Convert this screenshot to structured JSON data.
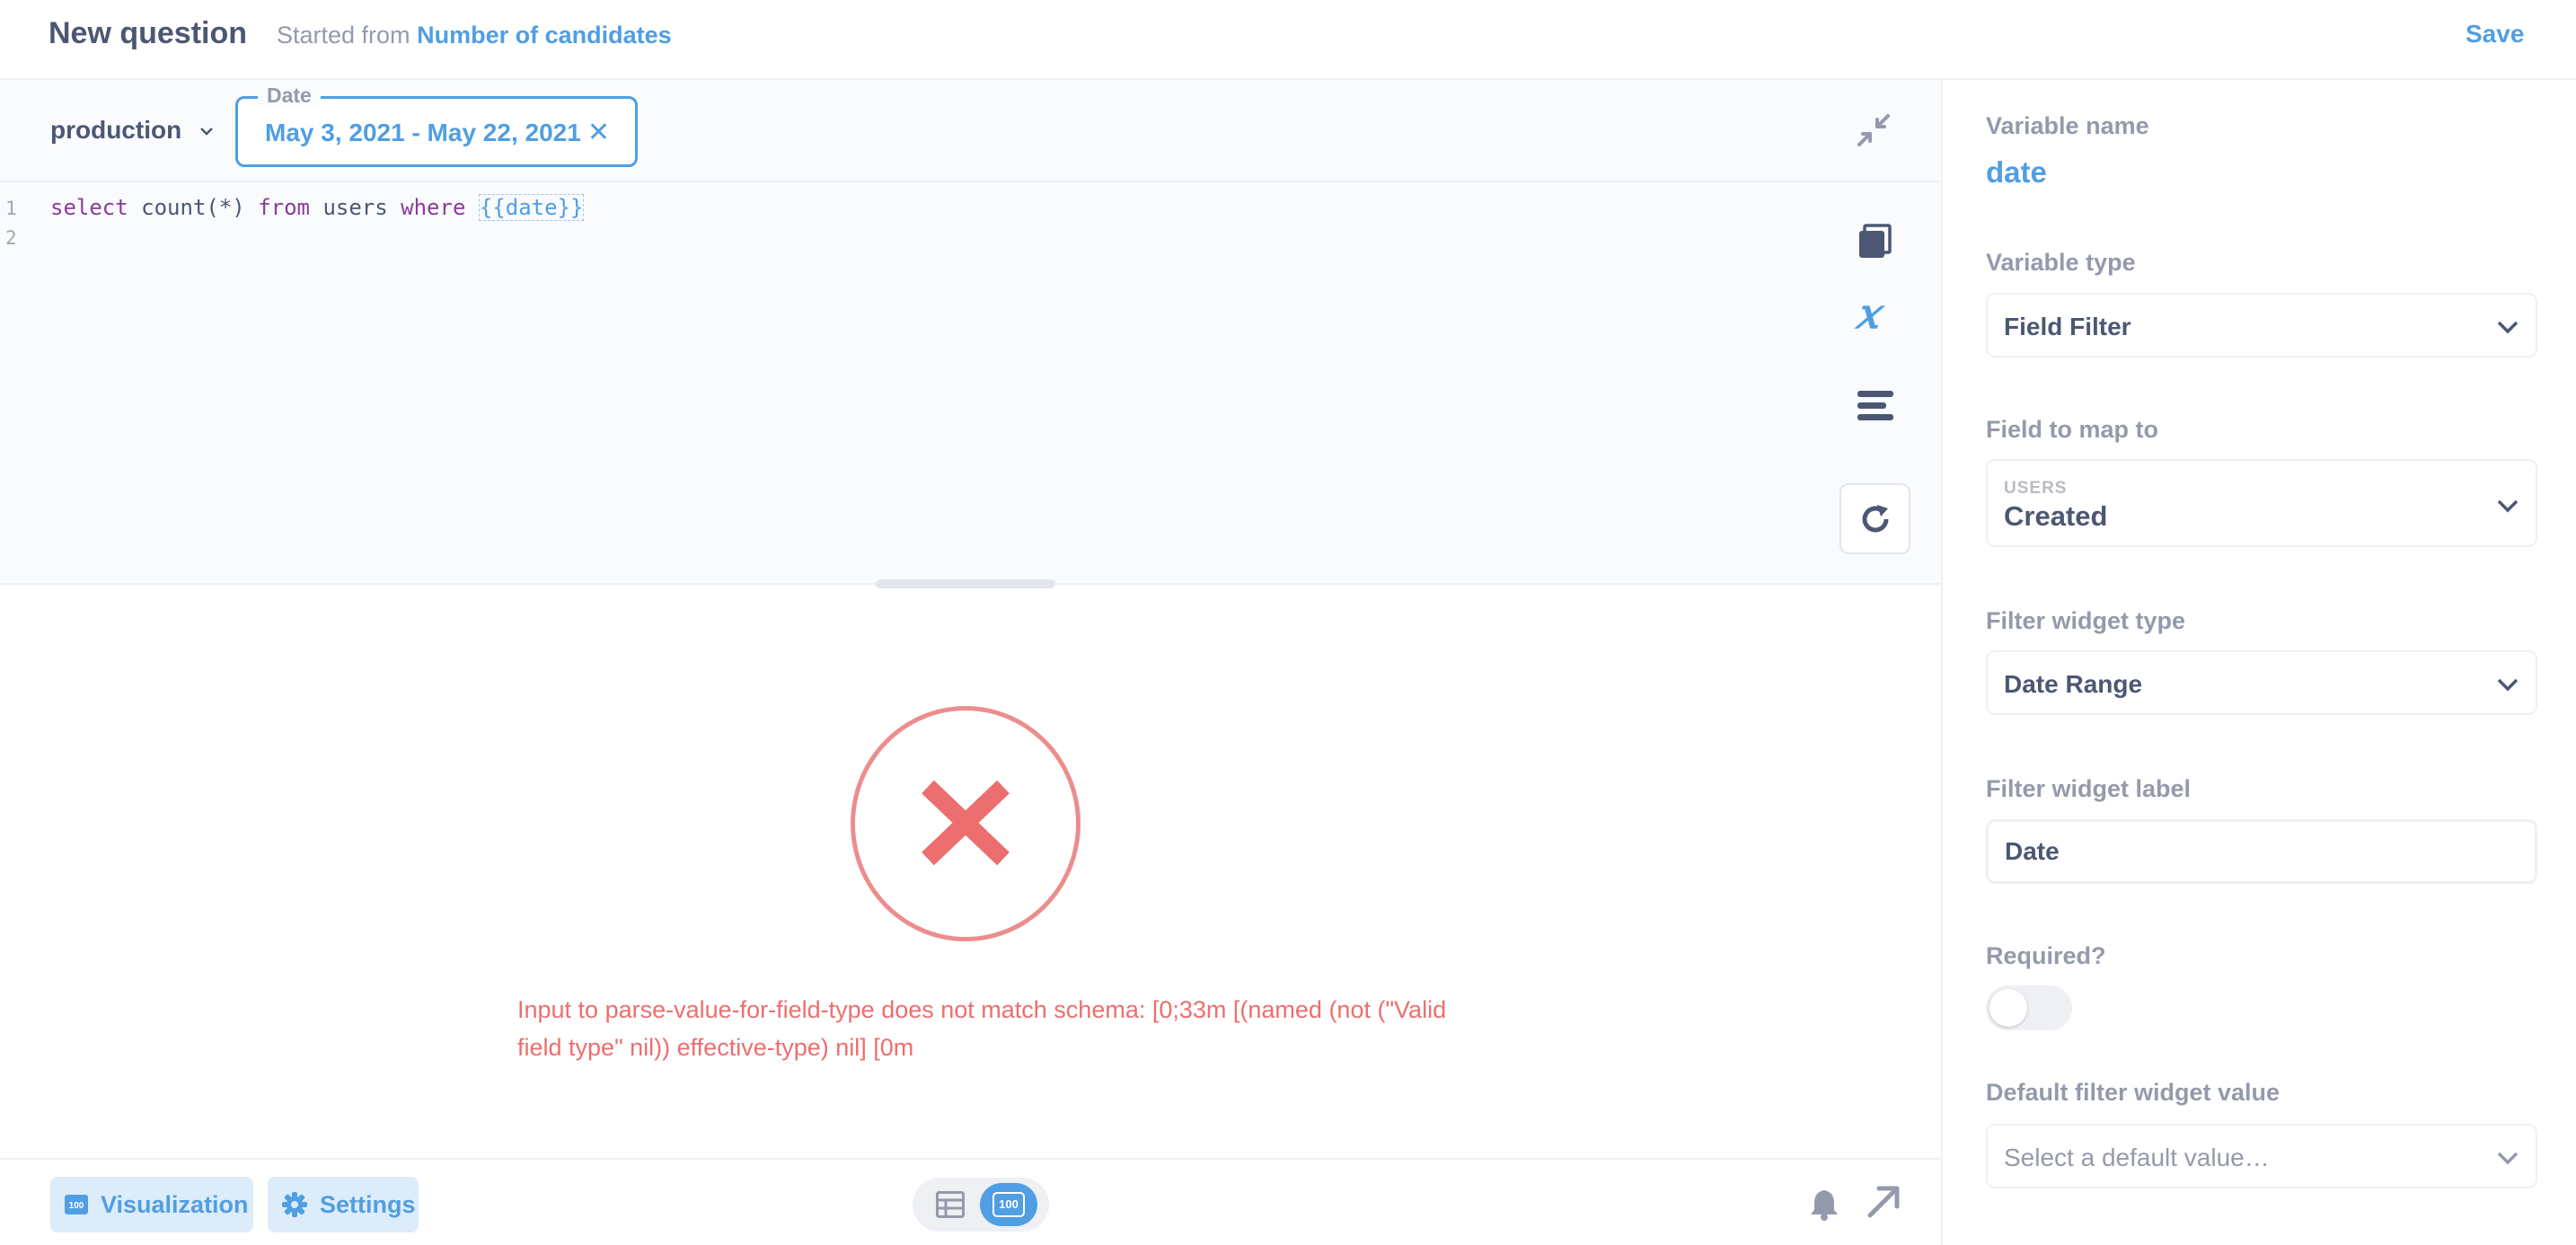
{
  "header": {
    "title": "New question",
    "started_from": "Started from",
    "source_name": "Number of candidates",
    "save_label": "Save"
  },
  "editor": {
    "database": "production",
    "date_filter": {
      "legend": "Date",
      "value": "May 3, 2021 - May 22, 2021",
      "clear": "✕"
    },
    "lines": [
      {
        "number": "1",
        "parts": [
          {
            "text": "select",
            "kind": "kw"
          },
          {
            "text": " count(*) ",
            "kind": "plain"
          },
          {
            "text": "from",
            "kind": "kw"
          },
          {
            "text": " users ",
            "kind": "plain"
          },
          {
            "text": "where",
            "kind": "kw"
          },
          {
            "text": " ",
            "kind": "plain"
          },
          {
            "text": "{{date}}",
            "kind": "tag"
          }
        ]
      },
      {
        "number": "2",
        "parts": []
      }
    ],
    "icons": [
      "collapse-icon",
      "data-reference-icon",
      "variables-icon",
      "snippets-icon",
      "refresh-icon"
    ]
  },
  "error": {
    "message": "Input to parse-value-for-field-type does not match schema:  [0;33m [(named (not (\"Valid field type\" nil)) effective-type) nil]  [0m"
  },
  "footer": {
    "visualization_label": "Visualization",
    "settings_label": "Settings",
    "number_badge": "100"
  },
  "panel": {
    "variable_name_label": "Variable name",
    "variable_name": "date",
    "variable_type_label": "Variable type",
    "variable_type": "Field Filter",
    "field_map_label": "Field to map to",
    "field_table": "USERS",
    "field_name": "Created",
    "widget_type_label": "Filter widget type",
    "widget_type": "Date Range",
    "widget_label_label": "Filter widget label",
    "widget_label_value": "Date",
    "required_label": "Required?",
    "required": false,
    "default_label": "Default filter widget value",
    "default_placeholder": "Select a default value…"
  },
  "colors": {
    "brand": "#509ee3",
    "text": "#4c5773",
    "muted": "#949aab",
    "error": "#ed6e6e",
    "keyword": "#8a3d99"
  }
}
